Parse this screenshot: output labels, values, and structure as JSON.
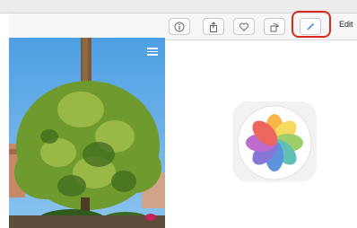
{
  "toolbar": {
    "buttons": [
      {
        "name": "info-button",
        "icon": "info-icon"
      },
      {
        "name": "share-button",
        "icon": "share-icon"
      },
      {
        "name": "favorite-button",
        "icon": "heart-icon"
      },
      {
        "name": "rotate-button",
        "icon": "rotate-icon"
      },
      {
        "name": "edit-tools-button",
        "icon": "magic-wand-icon"
      }
    ],
    "edit_label": "Edit"
  },
  "colors": {
    "highlight": "#d9291c",
    "toolbar_bg": "#f6f6f6",
    "sky": "#5aa8e6"
  },
  "photo": {
    "subject": "tree"
  },
  "app_icon": {
    "name": "photos-app-icon"
  }
}
